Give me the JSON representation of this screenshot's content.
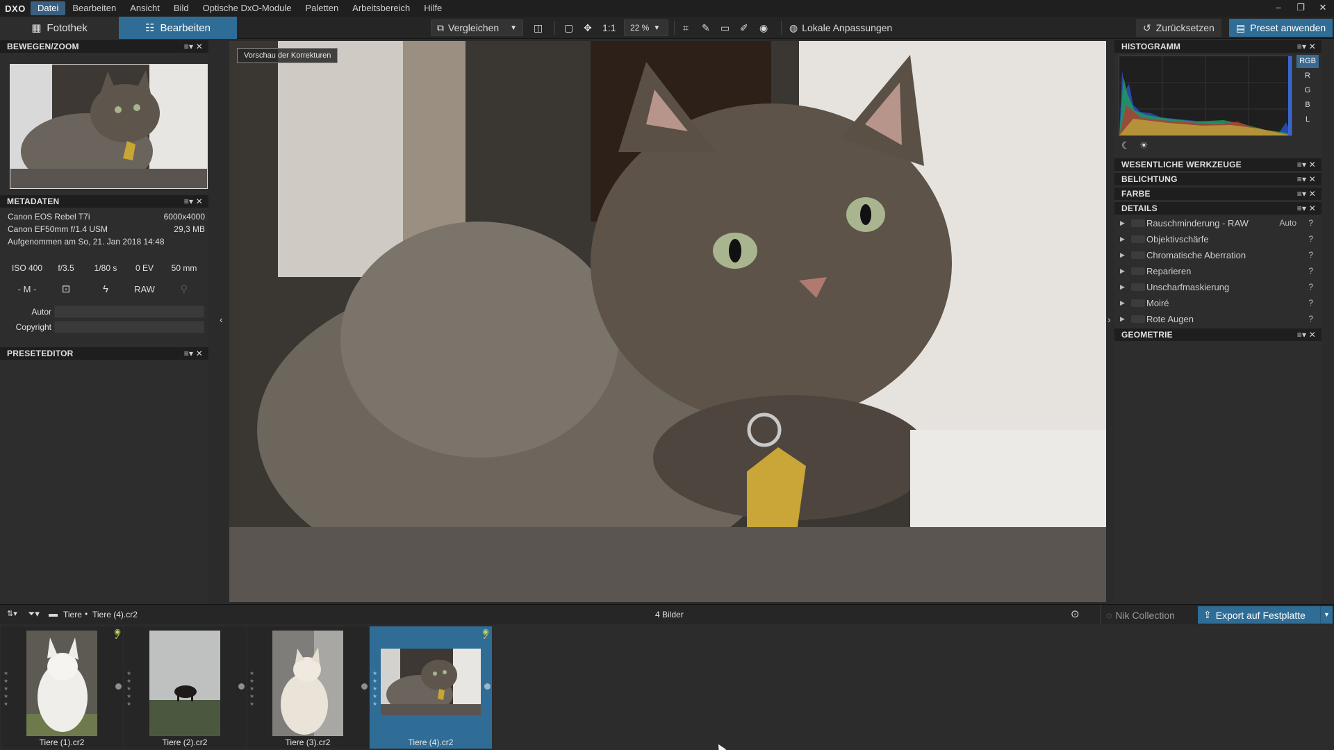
{
  "app": {
    "logo": "DXO"
  },
  "menu": [
    "Datei",
    "Bearbeiten",
    "Ansicht",
    "Bild",
    "Optische DxO-Module",
    "Paletten",
    "Arbeitsbereich",
    "Hilfe"
  ],
  "window_controls": [
    "–",
    "❐",
    "✕"
  ],
  "tabs": {
    "library": "Fotothek",
    "edit": "Bearbeiten"
  },
  "toolbar": {
    "compare": "Vergleichen",
    "one_to_one": "1:1",
    "zoom": "22 %",
    "local_adjust": "Lokale Anpassungen",
    "reset": "Zurücksetzen",
    "apply_preset": "Preset anwenden"
  },
  "left": {
    "move_zoom_title": "BEWEGEN/ZOOM",
    "metadata_title": "METADATEN",
    "camera": "Canon EOS Rebel T7i",
    "resolution": "6000x4000",
    "lens": "Canon EF50mm f/1.4 USM",
    "filesize": "29,3 MB",
    "captured": "Aufgenommen am So, 21. Jan 2018 14:48",
    "exif": [
      "ISO 400",
      "f/3.5",
      "1/80 s",
      "0 EV",
      "50 mm"
    ],
    "mode": "- M -",
    "raw": "RAW",
    "author_label": "Autor",
    "copyright_label": "Copyright",
    "preseteditor_title": "PRESETEDITOR"
  },
  "viewer": {
    "preview_label": "Vorschau der Korrekturen"
  },
  "right": {
    "histogram_title": "HISTOGRAMM",
    "channels": [
      "RGB",
      "R",
      "G",
      "B",
      "L"
    ],
    "sections": {
      "essential": "WESENTLICHE WERKZEUGE",
      "exposure": "BELICHTUNG",
      "color": "FARBE",
      "details": "DETAILS",
      "geometry": "GEOMETRIE"
    },
    "detail_items": [
      {
        "label": "Rauschminderung - RAW",
        "value": "Auto"
      },
      {
        "label": "Objektivschärfe",
        "value": ""
      },
      {
        "label": "Chromatische Aberration",
        "value": ""
      },
      {
        "label": "Reparieren",
        "value": ""
      },
      {
        "label": "Unscharfmaskierung",
        "value": ""
      },
      {
        "label": "Moiré",
        "value": ""
      },
      {
        "label": "Rote Augen",
        "value": ""
      }
    ]
  },
  "filmbar": {
    "breadcrumb_folder": "Tiere",
    "breadcrumb_file": "Tiere (4).cr2",
    "count": "4 Bilder",
    "nik": "Nik Collection",
    "export": "Export auf Festplatte"
  },
  "filmstrip": [
    {
      "name": "Tiere (1).cr2"
    },
    {
      "name": "Tiere (2).cr2"
    },
    {
      "name": "Tiere (3).cr2"
    },
    {
      "name": "Tiere (4).cr2"
    }
  ],
  "colors": {
    "accent": "#2f6d96",
    "panel": "#2d2d2d",
    "header": "#1e1e1e"
  }
}
